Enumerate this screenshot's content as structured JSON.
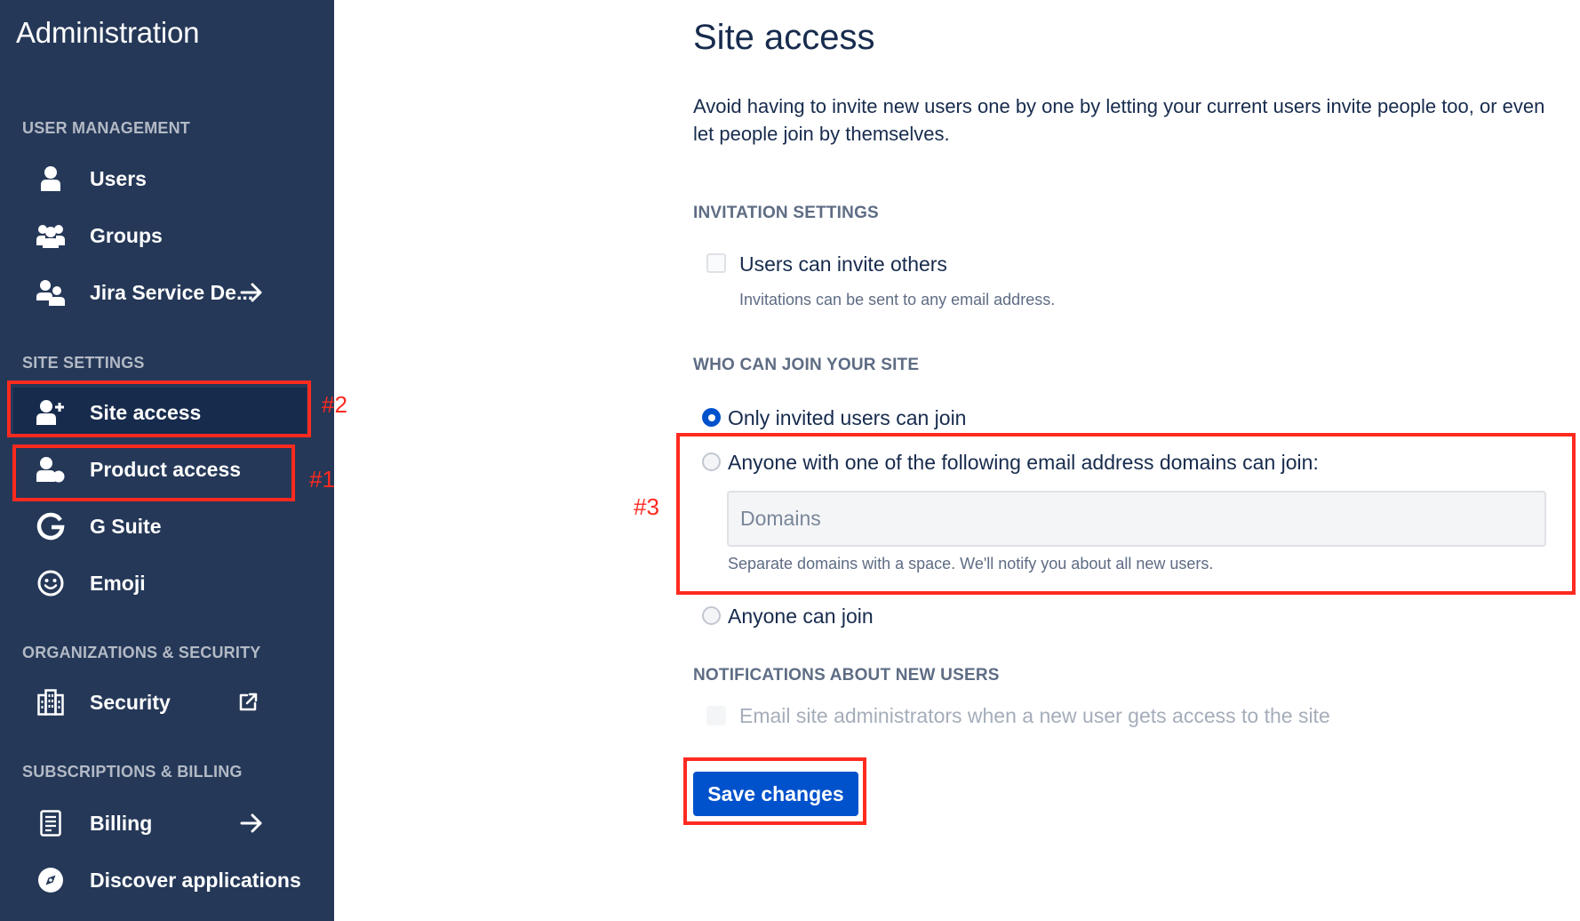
{
  "sidebar": {
    "title": "Administration",
    "sections": {
      "user_management": "USER MANAGEMENT",
      "site_settings": "SITE SETTINGS",
      "org_security": "ORGANIZATIONS & SECURITY",
      "billing": "SUBSCRIPTIONS & BILLING"
    },
    "items": {
      "users": {
        "label": "Users",
        "icon": "user-icon"
      },
      "groups": {
        "label": "Groups",
        "icon": "groups-icon"
      },
      "jira": {
        "label": "Jira Service De...",
        "icon": "people-icon",
        "trail_icon": "arrow-right-icon"
      },
      "site_access": {
        "label": "Site access",
        "icon": "add-user-icon",
        "selected": true
      },
      "product_access": {
        "label": "Product access",
        "icon": "product-access-icon"
      },
      "gsuite": {
        "label": "G Suite",
        "icon": "google-g-icon"
      },
      "emoji": {
        "label": "Emoji",
        "icon": "emoji-icon"
      },
      "security": {
        "label": "Security",
        "icon": "building-icon",
        "trail_icon": "external-link-icon"
      },
      "billing": {
        "label": "Billing",
        "icon": "document-icon",
        "trail_icon": "arrow-right-icon"
      },
      "discover": {
        "label": "Discover applications",
        "icon": "compass-icon"
      }
    }
  },
  "annotations": {
    "a1": "#1",
    "a2": "#2",
    "a3": "#3",
    "color": "#ff2a1f"
  },
  "main": {
    "title": "Site access",
    "intro": "Avoid having to invite new users one by one by letting your current users invite people too, or even let people join by themselves.",
    "invitation": {
      "heading": "INVITATION SETTINGS",
      "checkbox_label": "Users can invite others",
      "checked": false,
      "helper": "Invitations can be sent to any email address."
    },
    "who_can_join": {
      "heading": "WHO CAN JOIN YOUR SITE",
      "options": {
        "invited": "Only invited users can join",
        "domains": "Anyone with one of the following email address domains can join:",
        "anyone": "Anyone can join"
      },
      "selected": "invited",
      "domains_placeholder": "Domains",
      "domains_value": "",
      "domains_helper": "Separate domains with a space. We'll notify you about all new users."
    },
    "notifications": {
      "heading": "NOTIFICATIONS ABOUT NEW USERS",
      "checkbox_label": "Email site administrators when a new user gets access to the site",
      "disabled": true
    },
    "save_label": "Save changes"
  },
  "colors": {
    "sidebar_bg": "#253858",
    "sidebar_selected": "#172b4d",
    "primary": "#0052cc",
    "text": "#172b4d",
    "subtle_text": "#5e6c84"
  }
}
